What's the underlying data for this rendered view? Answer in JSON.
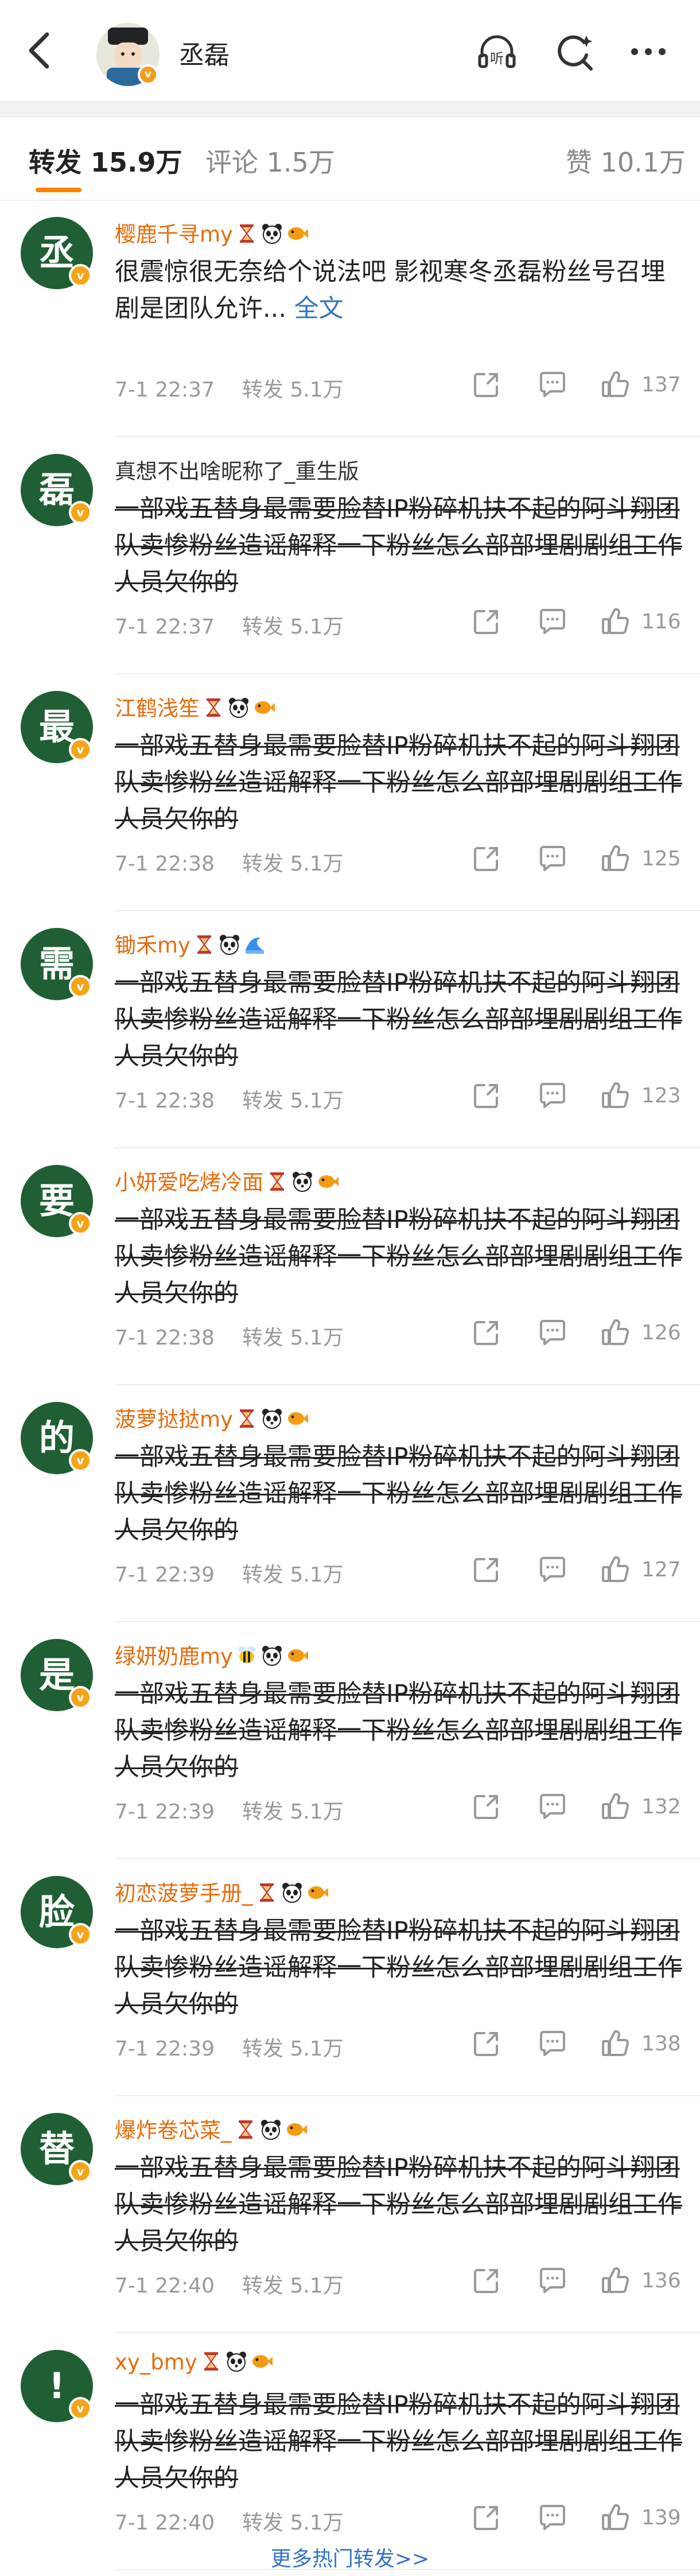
{
  "header": {
    "name": "丞磊",
    "avatar_badge": "v",
    "icons": [
      "back-icon",
      "listen-icon",
      "search-icon",
      "more-icon"
    ]
  },
  "tabs": [
    {
      "label": "转发 15.9万",
      "active": true
    },
    {
      "label": "评论 1.5万",
      "active": false
    },
    {
      "label": "赞 10.1万",
      "active": false
    }
  ],
  "items": [
    {
      "avatar_char": "丞",
      "name": "樱鹿千寻my",
      "name_color": "#e86b0a",
      "emojis": [
        "hourglass",
        "panda",
        "fish"
      ],
      "text": "很震惊很无奈给个说法吧 影视寒冬丞磊粉丝号召埋剧是团队允许...",
      "full": " 全文",
      "strike": false,
      "time": "7-1 22:37",
      "repost": "转发 5.1万",
      "likes": "137"
    },
    {
      "avatar_char": "磊",
      "name": "真想不出啥昵称了_重生版",
      "name_color": "#333333",
      "emojis": [],
      "text": "一部戏五替身最需要脸替IP粉碎机扶不起的阿斗翔团队卖惨粉丝造谣解释一下粉丝怎么部部埋剧剧组工作人员欠你的",
      "full": "",
      "strike": true,
      "time": "7-1 22:37",
      "repost": "转发 5.1万",
      "likes": "116"
    },
    {
      "avatar_char": "最",
      "name": "江鹤浅笙",
      "name_color": "#e86b0a",
      "emojis": [
        "hourglass",
        "panda",
        "fish"
      ],
      "text": "一部戏五替身最需要脸替IP粉碎机扶不起的阿斗翔团队卖惨粉丝造谣解释一下粉丝怎么部部埋剧剧组工作人员欠你的",
      "full": "",
      "strike": true,
      "time": "7-1 22:38",
      "repost": "转发 5.1万",
      "likes": "125"
    },
    {
      "avatar_char": "需",
      "name": "锄禾my",
      "name_color": "#e86b0a",
      "emojis": [
        "hourglass",
        "panda",
        "wave"
      ],
      "text": "一部戏五替身最需要脸替IP粉碎机扶不起的阿斗翔团队卖惨粉丝造谣解释一下粉丝怎么部部埋剧剧组工作人员欠你的",
      "full": "",
      "strike": true,
      "time": "7-1 22:38",
      "repost": "转发 5.1万",
      "likes": "123"
    },
    {
      "avatar_char": "要",
      "name": "小妍爱吃烤冷面",
      "name_color": "#e86b0a",
      "emojis": [
        "hourglass",
        "panda",
        "fish"
      ],
      "text": "一部戏五替身最需要脸替IP粉碎机扶不起的阿斗翔团队卖惨粉丝造谣解释一下粉丝怎么部部埋剧剧组工作人员欠你的",
      "full": "",
      "strike": true,
      "time": "7-1 22:38",
      "repost": "转发 5.1万",
      "likes": "126"
    },
    {
      "avatar_char": "的",
      "name": "菠萝挞挞my",
      "name_color": "#e86b0a",
      "emojis": [
        "hourglass",
        "panda",
        "fish"
      ],
      "text": "一部戏五替身最需要脸替IP粉碎机扶不起的阿斗翔团队卖惨粉丝造谣解释一下粉丝怎么部部埋剧剧组工作人员欠你的",
      "full": "",
      "strike": true,
      "time": "7-1 22:39",
      "repost": "转发 5.1万",
      "likes": "127"
    },
    {
      "avatar_char": "是",
      "name": "绿妍奶鹿my",
      "name_color": "#e86b0a",
      "emojis": [
        "bee",
        "panda",
        "fish"
      ],
      "text": "一部戏五替身最需要脸替IP粉碎机扶不起的阿斗翔团队卖惨粉丝造谣解释一下粉丝怎么部部埋剧剧组工作人员欠你的",
      "full": "",
      "strike": true,
      "time": "7-1 22:39",
      "repost": "转发 5.1万",
      "likes": "132"
    },
    {
      "avatar_char": "脸",
      "name": "初恋菠萝手册_",
      "name_color": "#e86b0a",
      "emojis": [
        "hourglass",
        "panda",
        "fish"
      ],
      "text": "一部戏五替身最需要脸替IP粉碎机扶不起的阿斗翔团队卖惨粉丝造谣解释一下粉丝怎么部部埋剧剧组工作人员欠你的",
      "full": "",
      "strike": true,
      "time": "7-1 22:39",
      "repost": "转发 5.1万",
      "likes": "138"
    },
    {
      "avatar_char": "替",
      "name": "爆炸卷芯菜_",
      "name_color": "#e86b0a",
      "emojis": [
        "hourglass",
        "panda",
        "fish"
      ],
      "text": "一部戏五替身最需要脸替IP粉碎机扶不起的阿斗翔团队卖惨粉丝造谣解释一下粉丝怎么部部埋剧剧组工作人员欠你的",
      "full": "",
      "strike": true,
      "time": "7-1 22:40",
      "repost": "转发 5.1万",
      "likes": "136"
    },
    {
      "avatar_char": "!",
      "name": "xy_bmy",
      "name_color": "#e86b0a",
      "emojis": [
        "hourglass",
        "panda",
        "fish"
      ],
      "text": "一部戏五替身最需要脸替IP粉碎机扶不起的阿斗翔团队卖惨粉丝造谣解释一下粉丝怎么部部埋剧剧组工作人员欠你的",
      "full": "",
      "strike": true,
      "time": "7-1 22:40",
      "repost": "转发 5.1万",
      "likes": "139"
    }
  ],
  "more_link": "更多热门转发>>"
}
